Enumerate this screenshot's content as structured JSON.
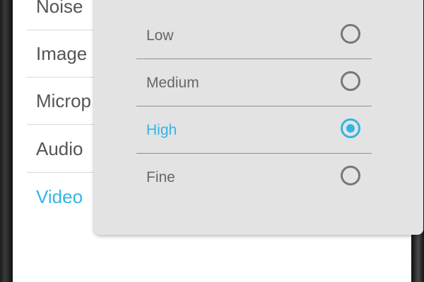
{
  "settings_list": {
    "items": [
      {
        "label": "Noise"
      },
      {
        "label": "Image"
      },
      {
        "label": "Microp"
      },
      {
        "label": "Audio"
      },
      {
        "label": "Video",
        "active": true
      }
    ]
  },
  "quality_dialog": {
    "options": [
      {
        "label": "Low",
        "selected": false
      },
      {
        "label": "Medium",
        "selected": false
      },
      {
        "label": "High",
        "selected": true
      },
      {
        "label": "Fine",
        "selected": false
      }
    ]
  },
  "colors": {
    "accent": "#33b5e5",
    "dialog_background": "#e3e3e3",
    "text": "#666666"
  }
}
